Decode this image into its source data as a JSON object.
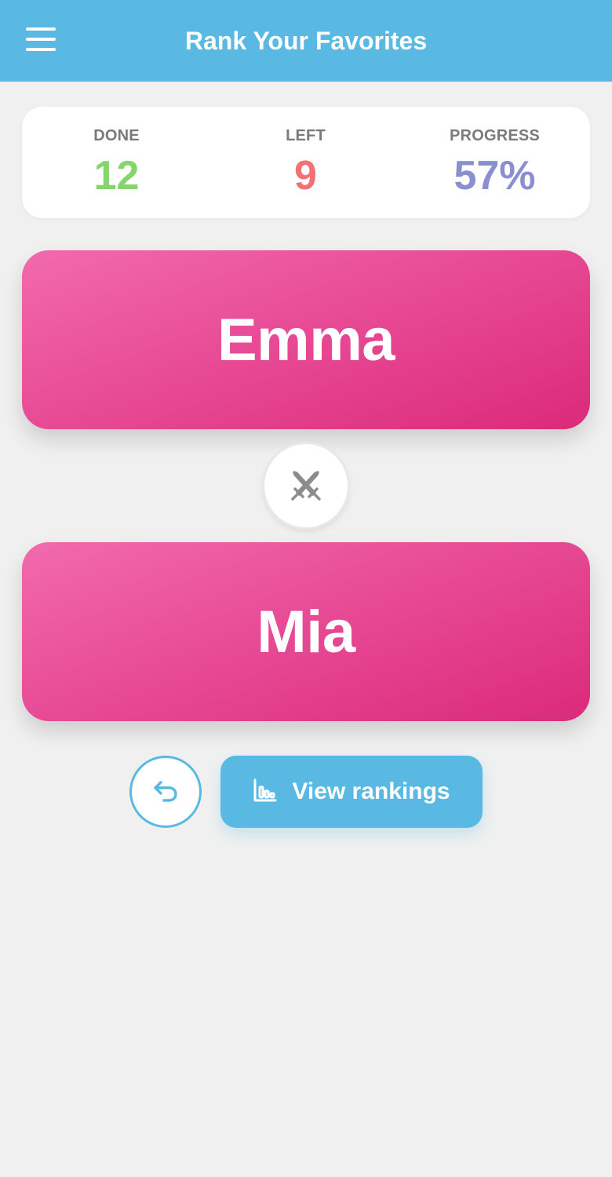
{
  "header": {
    "title": "Rank Your Favorites",
    "menu_icon": "hamburger-menu-icon",
    "background_color": "#59b9e3"
  },
  "stats": {
    "done": {
      "label": "DONE",
      "value": "12",
      "color": "#86d46c"
    },
    "left": {
      "label": "LEFT",
      "value": "9",
      "color": "#f07272"
    },
    "progress": {
      "label": "PROGRESS",
      "value": "57%",
      "color": "#8a8fd0"
    }
  },
  "matchup": {
    "option_a": "Emma",
    "option_b": "Mia",
    "versus_icon": "crossed-swords-icon",
    "card_color": "#e84c97"
  },
  "actions": {
    "undo_icon": "undo-arrow-icon",
    "rankings_icon": "bar-chart-icon",
    "view_rankings_label": "View rankings"
  }
}
